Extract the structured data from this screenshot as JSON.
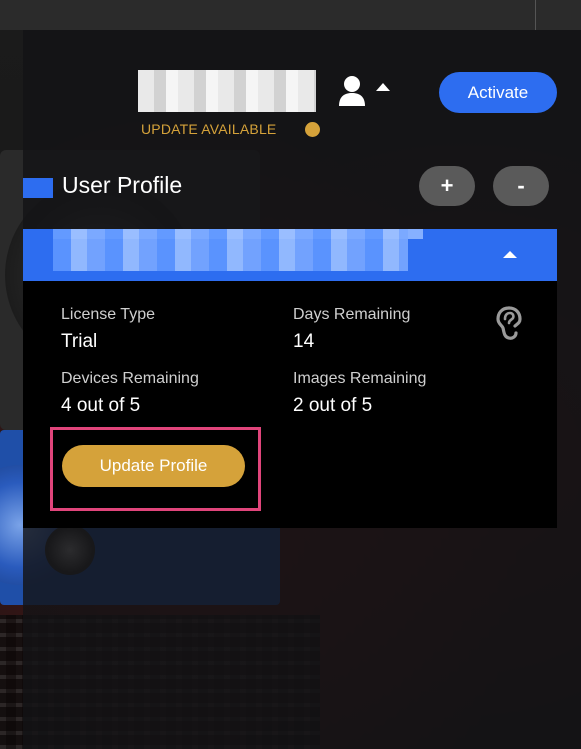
{
  "header": {
    "user_name": "",
    "activate_label": "Activate",
    "update_status": "UPDATE AVAILABLE"
  },
  "section": {
    "title": "User Profile",
    "add_label": "+",
    "remove_label": "-"
  },
  "profile": {
    "name": "",
    "license_type_label": "License Type",
    "license_type_value": "Trial",
    "days_remaining_label": "Days Remaining",
    "days_remaining_value": "14",
    "devices_remaining_label": "Devices Remaining",
    "devices_remaining_value": "4 out of 5",
    "images_remaining_label": "Images Remaining",
    "images_remaining_value": "2 out of 5",
    "update_button_label": "Update Profile"
  },
  "colors": {
    "accent_blue": "#2d6df0",
    "accent_gold": "#d5a23a",
    "highlight_pink": "#e0457b",
    "panel_black": "#000000"
  },
  "icons": [
    "user-icon",
    "caret-up-icon",
    "help-ear-icon"
  ]
}
